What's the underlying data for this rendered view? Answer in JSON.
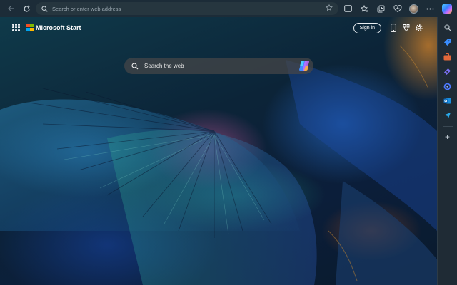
{
  "browser": {
    "address_placeholder": "Search or enter web address",
    "icons": [
      "back-icon",
      "refresh-icon",
      "search-icon",
      "favorite-star-icon",
      "split-screen-icon",
      "favorites-icon",
      "collections-icon",
      "browser-essentials-icon",
      "profile-avatar",
      "more-icon",
      "copilot-icon"
    ]
  },
  "page": {
    "brand": "Microsoft Start",
    "signin": "Sign in",
    "search_placeholder": "Search the web"
  },
  "sidebar": {
    "items": [
      "search-icon",
      "shopping-tag-icon",
      "tools-icon",
      "games-icon",
      "copilot-ring-icon",
      "outlook-icon",
      "send-icon",
      "add-icon"
    ]
  },
  "colors": {
    "toolbar": "#1c2c38",
    "sidebar": "#1f2b35",
    "ms_red": "#f25022",
    "ms_green": "#7fba00",
    "ms_blue": "#00a4ef",
    "ms_yellow": "#ffb900"
  }
}
